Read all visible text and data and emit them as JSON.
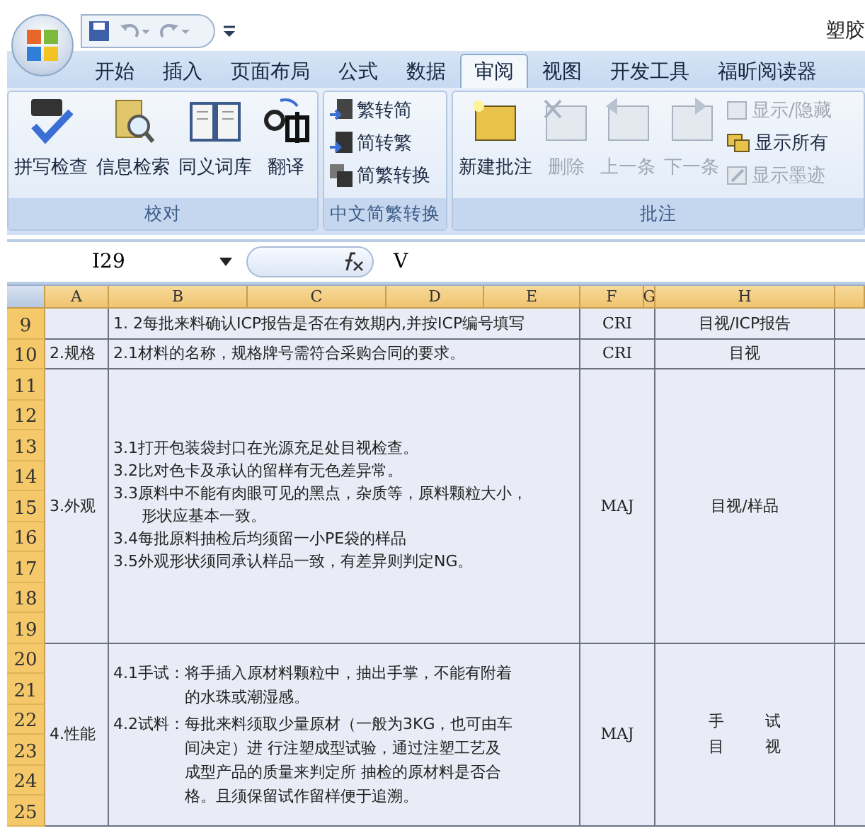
{
  "title_bar": {
    "title": "塑胶"
  },
  "tabs": [
    {
      "label": "开始",
      "selected": false
    },
    {
      "label": "插入",
      "selected": false
    },
    {
      "label": "页面布局",
      "selected": false
    },
    {
      "label": "公式",
      "selected": false
    },
    {
      "label": "数据",
      "selected": false
    },
    {
      "label": "审阅",
      "selected": true
    },
    {
      "label": "视图",
      "selected": false
    },
    {
      "label": "开发工具",
      "selected": false
    },
    {
      "label": "福昕阅读器",
      "selected": false
    }
  ],
  "ribbon": {
    "groups": [
      {
        "label": "校对",
        "large": [
          {
            "kind": "spell",
            "label": "拼写检查",
            "disabled": false
          },
          {
            "kind": "research",
            "label": "信息检索",
            "disabled": false
          },
          {
            "kind": "thesaurus",
            "label": "同义词库",
            "disabled": false
          },
          {
            "kind": "translate",
            "label": "翻译",
            "disabled": false
          }
        ]
      },
      {
        "label": "中文简繁转换",
        "small": [
          {
            "kind": "to-simple",
            "label": "繁转简",
            "disabled": false
          },
          {
            "kind": "to-traditional",
            "label": "简转繁",
            "disabled": false
          },
          {
            "kind": "convert",
            "label": "简繁转换",
            "disabled": false
          }
        ]
      },
      {
        "label": "批注",
        "large": [
          {
            "kind": "new-note",
            "label": "新建批注",
            "disabled": false
          },
          {
            "kind": "delete-note",
            "label": "删除",
            "disabled": true
          },
          {
            "kind": "prev-note",
            "label": "上一条",
            "disabled": true
          },
          {
            "kind": "next-note",
            "label": "下一条",
            "disabled": true
          }
        ],
        "small": [
          {
            "kind": "show-hide",
            "label": "显示/隐藏",
            "disabled": true
          },
          {
            "kind": "show-all",
            "label": "显示所有",
            "disabled": false
          },
          {
            "kind": "ink",
            "label": "显示墨迹",
            "disabled": true
          }
        ]
      }
    ]
  },
  "formula_bar": {
    "name_box": "I29",
    "value": "V"
  },
  "sheet": {
    "columns": [
      "A",
      "B",
      "C",
      "D",
      "E",
      "F",
      "G",
      "H"
    ],
    "sections": [
      {
        "rows": [
          "9"
        ],
        "kind": "single",
        "text": "1. 2每批来料确认ICP报告是否在有效期内,并按ICP编号填写",
        "level": "CRI",
        "method": [
          "目视/ICP报告"
        ]
      },
      {
        "rows": [
          "10"
        ],
        "category": "2.规格",
        "kind": "single",
        "text": "2.1材料的名称，规格牌号需符合采购合同的要求。",
        "level": "CRI",
        "method": [
          "目视"
        ]
      },
      {
        "rows": [
          "11",
          "12",
          "13",
          "14",
          "15",
          "16",
          "17",
          "18",
          "19"
        ],
        "category": "3.外观",
        "kind": "list",
        "lines": [
          "3.1打开包装袋封口在光源充足处目视检查。",
          "3.2比对色卡及承认的留样有无色差异常。",
          "3.3原料中不能有肉眼可见的黑点，杂质等，原料颗粒大小，形状应基本一致。",
          "3.4每批原料抽检后均须留一小PE袋的样品",
          "3.5外观形状须同承认样品一致，有差异则判定NG。"
        ],
        "level": "MAJ",
        "method": [
          "目视/样品"
        ]
      },
      {
        "rows": [
          "20",
          "21",
          "22",
          "23",
          "24",
          "25"
        ],
        "category": "4.性能",
        "kind": "labeled",
        "items": [
          {
            "label": "4.1手试：",
            "text": "将手插入原材料颗粒中，抽出手掌，不能有附着的水珠或潮湿感。"
          },
          {
            "label": "4.2试料：",
            "text": "每批来料须取少量原材（一般为3KG，也可由车间决定）进 行注塑成型试验，通过注塑工艺及成型产品的质量来判定所 抽检的原材料是否合格。且须保留试作留样便于追溯。"
          }
        ],
        "level": "MAJ",
        "method": [
          "手",
          "试",
          "目",
          "视"
        ]
      }
    ]
  }
}
